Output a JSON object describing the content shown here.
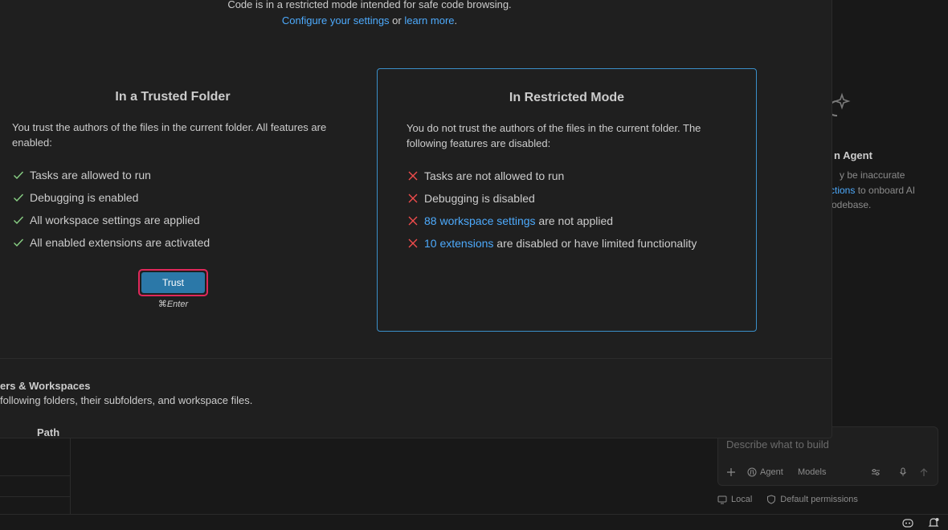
{
  "dialog": {
    "intro": {
      "line1": "Code is in a restricted mode intended for safe code browsing.",
      "configure_link": "Configure your settings",
      "or_text": " or ",
      "learn_link": "learn more",
      "period": "."
    },
    "trusted": {
      "title": "In a Trusted Folder",
      "description": "You trust the authors of the files in the current folder. All features are enabled:",
      "features": [
        "Tasks are allowed to run",
        "Debugging is enabled",
        "All workspace settings are applied",
        "All enabled extensions are activated"
      ],
      "button_label": "Trust",
      "shortcut": "⌘Enter"
    },
    "restricted": {
      "title": "In Restricted Mode",
      "description": "You do not trust the authors of the files in the current folder. The following features are disabled:",
      "features": [
        {
          "text": "Tasks are not allowed to run"
        },
        {
          "text": "Debugging is disabled"
        },
        {
          "link": "88 workspace settings",
          "text": " are not applied"
        },
        {
          "link": "10 extensions",
          "text": " are disabled or have limited functionality"
        }
      ]
    },
    "folders": {
      "heading": "ers & Workspaces",
      "description": "following folders, their subfolders, and workspace files.",
      "path_header": "Path"
    }
  },
  "chat": {
    "heading": "n Agent",
    "para_line1": "y be inaccurate",
    "para_line2_link": "ctions",
    "para_line2_rest": " to onboard AI",
    "para_line3": "odebase.",
    "input_placeholder": "Describe what to build",
    "mode_label": "Agent",
    "models_label": "Models",
    "footer_local": "Local",
    "footer_permissions": "Default permissions"
  },
  "colors": {
    "accent_link": "#4daafc",
    "restricted_border": "#3a8fc9",
    "check_green": "#89d185",
    "cross_red": "#f14c4c",
    "trust_button": "#2b78a8",
    "focus_ring": "#e0285a"
  }
}
